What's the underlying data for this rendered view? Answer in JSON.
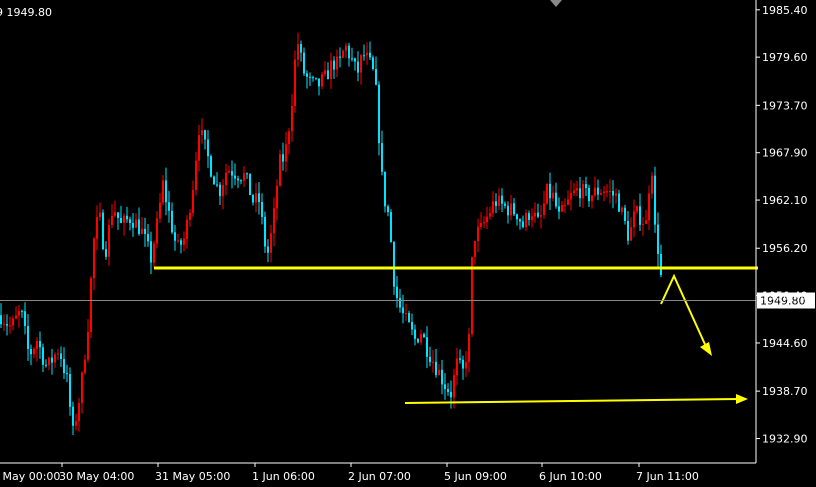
{
  "header": {
    "title": "9 1949.80"
  },
  "colors": {
    "background": "#000000",
    "bull": "#ff0000",
    "bear": "#00e5ff",
    "axis": "#ffffff",
    "annotation": "#ffff00",
    "price_line": "#888888",
    "price_label_bg": "#ffffff",
    "price_label_fg": "#000000"
  },
  "chart_data": {
    "type": "candlestick",
    "ylim": [
      1929.9,
      1986.6
    ],
    "y_ticks": [
      "1985.40",
      "1979.60",
      "1973.70",
      "1967.90",
      "1962.10",
      "1956.20",
      "1950.40",
      "1944.60",
      "1938.70",
      "1932.90"
    ],
    "x_ticks": [
      "9 May 00:00",
      "30 May 04:00",
      "31 May 05:00",
      "1 Jun 06:00",
      "2 Jun 07:00",
      "5 Jun 09:00",
      "6 Jun 10:00",
      "7 Jun 11:00"
    ],
    "current_price": "1949.80",
    "path": [
      [
        0,
        1948.0
      ],
      [
        10,
        1946.5
      ],
      [
        20,
        1948.5
      ],
      [
        28,
        1943.0
      ],
      [
        36,
        1945.0
      ],
      [
        46,
        1941.5
      ],
      [
        58,
        1944.0
      ],
      [
        66,
        1940.0
      ],
      [
        72,
        1933.5
      ],
      [
        80,
        1939.0
      ],
      [
        88,
        1948.0
      ],
      [
        92,
        1956.5
      ],
      [
        98,
        1960.5
      ],
      [
        104,
        1955.5
      ],
      [
        112,
        1961.5
      ],
      [
        120,
        1959.0
      ],
      [
        130,
        1960.0
      ],
      [
        140,
        1958.5
      ],
      [
        150,
        1955.0
      ],
      [
        156,
        1959.0
      ],
      [
        162,
        1964.0
      ],
      [
        168,
        1960.5
      ],
      [
        176,
        1956.0
      ],
      [
        184,
        1957.5
      ],
      [
        192,
        1964.0
      ],
      [
        198,
        1971.0
      ],
      [
        204,
        1968.5
      ],
      [
        210,
        1966.0
      ],
      [
        218,
        1963.0
      ],
      [
        226,
        1966.0
      ],
      [
        234,
        1965.5
      ],
      [
        244,
        1965.0
      ],
      [
        252,
        1962.0
      ],
      [
        258,
        1962.0
      ],
      [
        266,
        1955.0
      ],
      [
        272,
        1959.0
      ],
      [
        278,
        1966.5
      ],
      [
        284,
        1967.5
      ],
      [
        290,
        1973.0
      ],
      [
        296,
        1982.0
      ],
      [
        302,
        1978.0
      ],
      [
        308,
        1976.5
      ],
      [
        316,
        1976.0
      ],
      [
        324,
        1977.0
      ],
      [
        332,
        1979.0
      ],
      [
        338,
        1978.5
      ],
      [
        344,
        1981.0
      ],
      [
        350,
        1979.5
      ],
      [
        356,
        1977.5
      ],
      [
        362,
        1980.0
      ],
      [
        368,
        1979.0
      ],
      [
        374,
        1977.0
      ],
      [
        378,
        1970.0
      ],
      [
        382,
        1963.0
      ],
      [
        388,
        1960.0
      ],
      [
        394,
        1951.0
      ],
      [
        400,
        1948.5
      ],
      [
        408,
        1946.5
      ],
      [
        414,
        1945.0
      ],
      [
        420,
        1946.0
      ],
      [
        426,
        1944.0
      ],
      [
        432,
        1942.5
      ],
      [
        438,
        1941.0
      ],
      [
        444,
        1939.5
      ],
      [
        450,
        1938.5
      ],
      [
        456,
        1942.0
      ],
      [
        462,
        1941.0
      ],
      [
        468,
        1945.0
      ],
      [
        472,
        1957.5
      ],
      [
        480,
        1958.5
      ],
      [
        488,
        1960.5
      ],
      [
        494,
        1962.0
      ],
      [
        500,
        1961.5
      ],
      [
        508,
        1961.0
      ],
      [
        516,
        1960.5
      ],
      [
        522,
        1959.0
      ],
      [
        530,
        1961.0
      ],
      [
        538,
        1959.0
      ],
      [
        546,
        1963.0
      ],
      [
        552,
        1962.5
      ],
      [
        558,
        1960.0
      ],
      [
        564,
        1961.0
      ],
      [
        570,
        1962.5
      ],
      [
        578,
        1963.5
      ],
      [
        586,
        1962.5
      ],
      [
        594,
        1963.0
      ],
      [
        602,
        1963.5
      ],
      [
        608,
        1963.0
      ],
      [
        616,
        1962.5
      ],
      [
        622,
        1960.0
      ],
      [
        628,
        1957.5
      ],
      [
        634,
        1960.5
      ],
      [
        640,
        1960.0
      ],
      [
        646,
        1959.0
      ],
      [
        650,
        1968.5
      ],
      [
        654,
        1958.5
      ],
      [
        658,
        1955.5
      ],
      [
        662,
        1949.8
      ]
    ]
  }
}
